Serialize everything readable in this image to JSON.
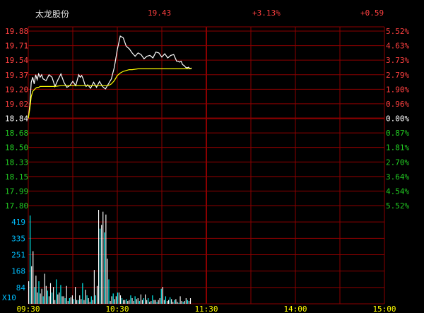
{
  "header": {
    "name": "太龙股份",
    "price": "19.43",
    "change_pct": "+3.13%",
    "change": "+0.59"
  },
  "chart_data": [
    {
      "type": "line",
      "series": [
        {
          "x": [
            "09:30",
            "09:31",
            "09:32",
            "09:33",
            "09:34",
            "09:35",
            "09:36",
            "09:37",
            "09:38",
            "09:39",
            "09:40",
            "09:42",
            "09:44",
            "09:46",
            "09:48",
            "09:50",
            "09:52",
            "09:54",
            "09:56",
            "09:58",
            "10:00",
            "10:02",
            "10:04",
            "10:05",
            "10:06",
            "10:07",
            "10:08",
            "10:09",
            "10:10",
            "10:12",
            "10:14",
            "10:16",
            "10:18",
            "10:20",
            "10:22",
            "10:24",
            "10:26",
            "10:28",
            "10:30",
            "10:32",
            "10:34",
            "10:36",
            "10:38",
            "10:40",
            "10:42",
            "10:44",
            "10:46",
            "10:48",
            "10:50",
            "10:52",
            "10:54",
            "10:56",
            "10:58",
            "11:00",
            "11:02",
            "11:04",
            "11:06",
            "11:08",
            "11:10",
            "11:11",
            "11:12",
            "11:13",
            "11:14",
            "11:15",
            "11:16",
            "11:17",
            "11:18",
            "11:19",
            "11:20"
          ],
          "values": [
            18.84,
            18.99,
            19.27,
            19.33,
            19.25,
            19.36,
            19.3,
            19.37,
            19.33,
            19.36,
            19.31,
            19.29,
            19.36,
            19.33,
            19.22,
            19.3,
            19.37,
            19.27,
            19.21,
            19.23,
            19.28,
            19.23,
            19.36,
            19.33,
            19.35,
            19.31,
            19.25,
            19.22,
            19.24,
            19.2,
            19.27,
            19.21,
            19.28,
            19.22,
            19.19,
            19.25,
            19.31,
            19.45,
            19.66,
            19.82,
            19.8,
            19.7,
            19.67,
            19.62,
            19.58,
            19.62,
            19.6,
            19.55,
            19.58,
            19.59,
            19.56,
            19.63,
            19.62,
            19.57,
            19.61,
            19.56,
            19.59,
            19.6,
            19.52,
            19.52,
            19.51,
            19.52,
            19.48,
            19.47,
            19.45,
            19.44,
            19.45,
            19.43,
            19.44
          ]
        },
        {
          "x": [
            "09:30",
            "09:31",
            "09:32",
            "09:33",
            "09:34",
            "09:35",
            "09:36",
            "09:37",
            "09:38",
            "09:40",
            "09:44",
            "09:48",
            "09:52",
            "09:56",
            "10:00",
            "10:04",
            "10:08",
            "10:12",
            "10:16",
            "10:20",
            "10:24",
            "10:26",
            "10:28",
            "10:30",
            "10:32",
            "10:34",
            "10:36",
            "10:38",
            "10:40",
            "10:44",
            "10:48",
            "10:52",
            "10:56",
            "11:00",
            "11:04",
            "11:08",
            "11:12",
            "11:16",
            "11:20"
          ],
          "values": [
            18.84,
            18.95,
            19.1,
            19.16,
            19.18,
            19.2,
            19.21,
            19.21,
            19.22,
            19.22,
            19.22,
            19.22,
            19.23,
            19.23,
            19.23,
            19.23,
            19.23,
            19.23,
            19.23,
            19.23,
            19.23,
            19.25,
            19.29,
            19.35,
            19.38,
            19.4,
            19.41,
            19.42,
            19.42,
            19.43,
            19.43,
            19.43,
            19.43,
            19.43,
            19.43,
            19.43,
            19.43,
            19.43,
            19.43
          ]
        }
      ],
      "ylim": [
        17.8,
        19.88
      ],
      "y_ticks_left": [
        "19.88",
        "19.71",
        "19.54",
        "19.37",
        "19.20",
        "19.02",
        "18.84",
        "18.68",
        "18.50",
        "18.33",
        "18.15",
        "17.99",
        "17.80"
      ],
      "y_ticks_right": [
        "5.52%",
        "4.63%",
        "3.73%",
        "2.79%",
        "1.90%",
        "0.96%",
        "0.00%",
        "0.87%",
        "1.81%",
        "2.70%",
        "3.64%",
        "4.54%",
        "5.52%"
      ],
      "x_ticks": [
        "09:30",
        "10:30",
        "11:30",
        "14:00",
        "15:00"
      ],
      "grid": true,
      "colors": {
        "price_line": "#ffffff",
        "avg_line": "#ffff00",
        "grid": "#8b0000",
        "up": "#ff4040",
        "base": "#ffffff",
        "down": "#22cc22",
        "time": "#ffff00"
      }
    },
    {
      "type": "bar",
      "ylim": [
        0,
        500
      ],
      "y_ticks": [
        "419",
        "335",
        "251",
        "168",
        "84"
      ],
      "unit": "X10",
      "values": [
        120,
        470,
        200,
        280,
        90,
        150,
        60,
        120,
        55,
        80,
        40,
        160,
        95,
        70,
        40,
        110,
        60,
        90,
        20,
        130,
        50,
        60,
        100,
        40,
        40,
        30,
        95,
        15,
        30,
        35,
        45,
        25,
        90,
        20,
        20,
        45,
        25,
        110,
        20,
        75,
        45,
        30,
        10,
        40,
        20,
        180,
        45,
        95,
        500,
        400,
        420,
        490,
        380,
        475,
        240,
        130,
        15,
        40,
        55,
        25,
        40,
        60,
        60,
        45,
        30,
        20,
        20,
        25,
        15,
        20,
        45,
        30,
        15,
        40,
        25,
        30,
        15,
        50,
        20,
        30,
        50,
        20,
        30,
        10,
        15,
        45,
        20,
        20,
        10,
        20,
        30,
        80,
        90,
        20,
        40,
        15,
        20,
        35,
        25,
        10,
        20,
        25,
        10,
        5,
        40,
        15,
        10,
        15,
        30,
        20,
        15,
        30
      ],
      "colors": {
        "up": "#ffffff",
        "down": "#00ffff",
        "axis_text": "#00bfff"
      }
    }
  ]
}
